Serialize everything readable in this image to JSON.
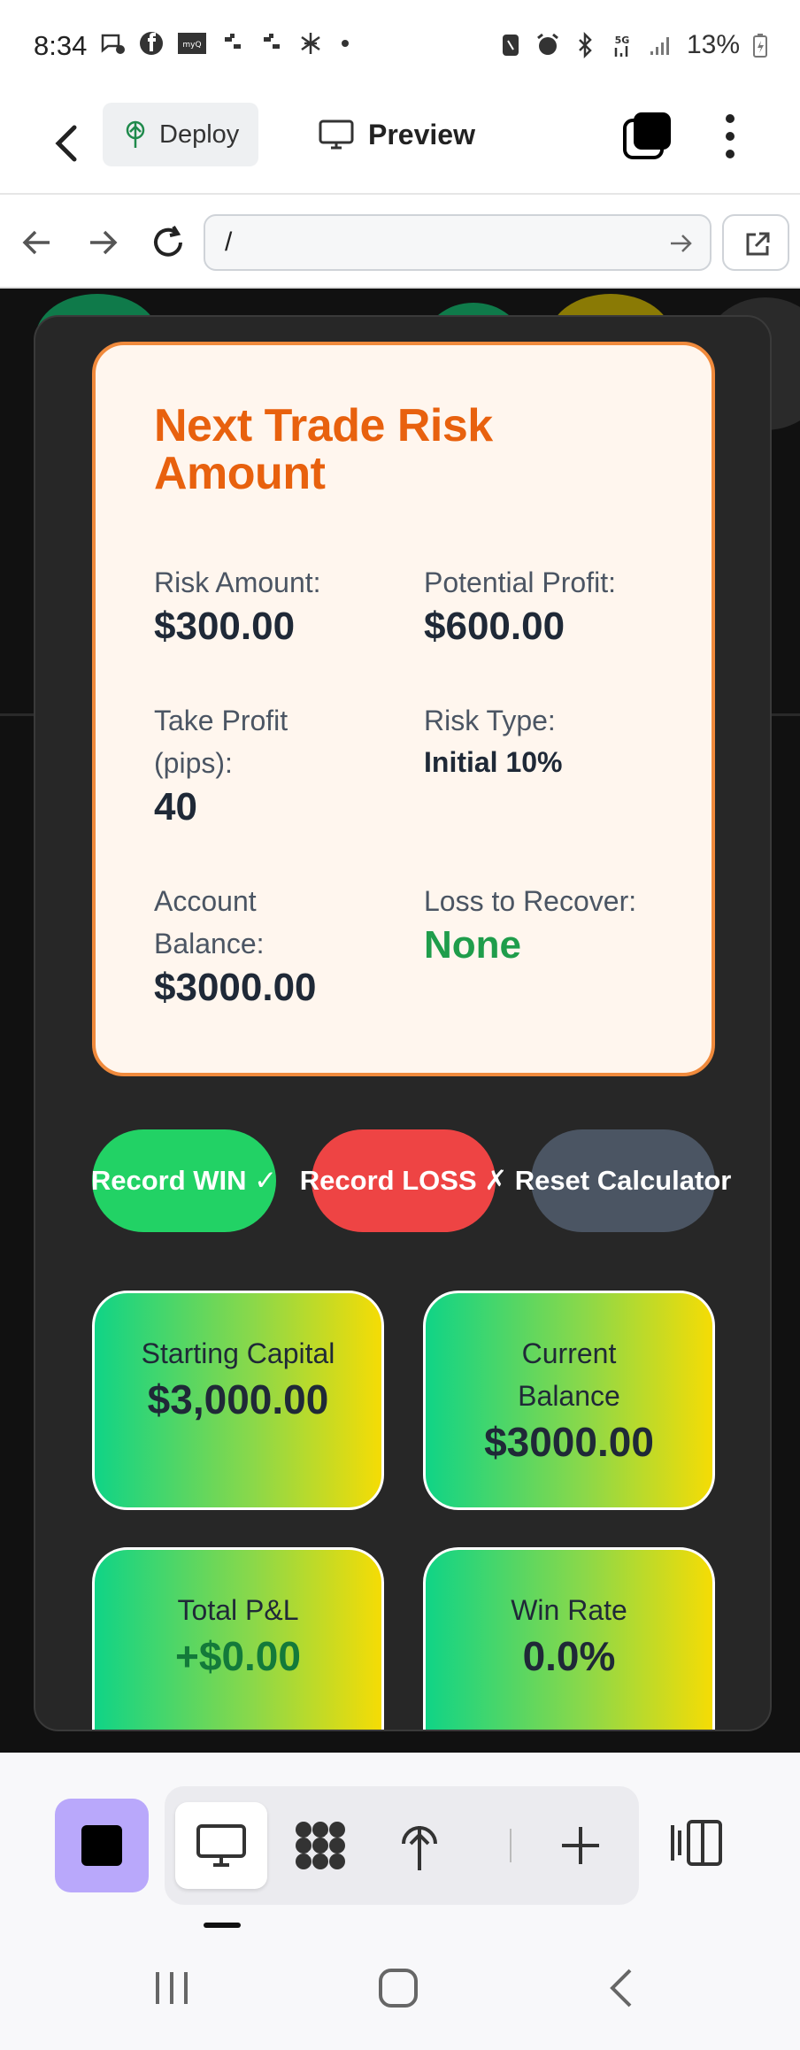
{
  "status_bar": {
    "time": "8:34",
    "battery": "13%",
    "left_icons": [
      "chat-bubble-icon",
      "facebook-icon",
      "myq-icon",
      "slack-icon",
      "slack-icon",
      "bug-icon",
      "dot-icon"
    ],
    "right_icons": [
      "bluetooth-icon",
      "alarm-icon",
      "bluetooth-icon",
      "5g-icon",
      "signal-icon"
    ]
  },
  "app_bar": {
    "deploy_label": "Deploy",
    "preview_label": "Preview"
  },
  "url_bar": {
    "url": "/"
  },
  "risk_card": {
    "title": "Next Trade Risk Amount",
    "risk_amount_label": "Risk Amount:",
    "risk_amount_value": "$300.00",
    "potential_profit_label": "Potential Profit:",
    "potential_profit_value": "$600.00",
    "take_profit_label": "Take Profit (pips):",
    "take_profit_value": "40",
    "risk_type_label": "Risk Type:",
    "risk_type_value": "Initial 10%",
    "account_balance_label": "Account Balance:",
    "account_balance_value": "$3000.00",
    "loss_to_recover_label": "Loss to Recover:",
    "loss_to_recover_value": "None"
  },
  "actions": {
    "win_label": "Record WIN ✓",
    "loss_label": "Record LOSS ✗",
    "reset_label": "Reset Calculator"
  },
  "metrics": {
    "starting_capital_label": "Starting Capital",
    "starting_capital_value": "$3,000.00",
    "current_balance_label": "Current Balance",
    "current_balance_value": "$3000.00",
    "total_pnl_label": "Total P&L",
    "total_pnl_value": "+$0.00",
    "win_rate_label": "Win Rate",
    "win_rate_value": "0.0%"
  },
  "colors": {
    "accent_orange": "#e8610e",
    "win_green": "#22d265",
    "loss_red": "#ee4444",
    "reset_gray": "#4b5563",
    "toolbar_accent": "#b9a8fb"
  }
}
